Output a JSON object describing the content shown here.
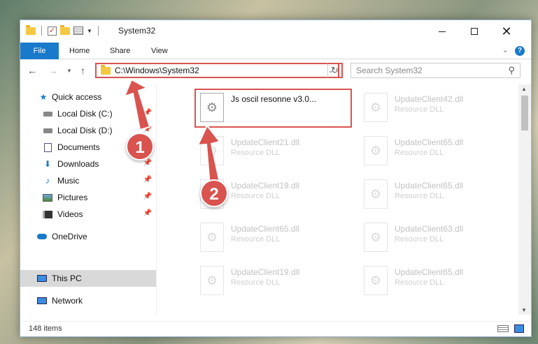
{
  "window": {
    "title": "System32",
    "minimize_icon": "minimize-icon",
    "maximize_icon": "maximize-icon",
    "close_glyph": "✕"
  },
  "ribbon": {
    "file_tab": "File",
    "tabs": [
      "Home",
      "Share",
      "View"
    ],
    "expand_glyph": "⌄",
    "help_glyph": "?"
  },
  "address": {
    "path": "C:\\Windows\\System32",
    "search_placeholder": "Search System32"
  },
  "sidebar": {
    "items": [
      {
        "label": "Quick access",
        "icon": "star-icon"
      },
      {
        "label": "Local Disk (C:)",
        "icon": "disk-icon",
        "pinned": true
      },
      {
        "label": "Local Disk (D:)",
        "icon": "disk-icon",
        "pinned": true
      },
      {
        "label": "Documents",
        "icon": "document-icon",
        "pinned": true
      },
      {
        "label": "Downloads",
        "icon": "download-icon",
        "pinned": true
      },
      {
        "label": "Music",
        "icon": "music-icon",
        "pinned": true
      },
      {
        "label": "Pictures",
        "icon": "picture-icon",
        "pinned": true
      },
      {
        "label": "Videos",
        "icon": "video-icon",
        "pinned": true
      },
      {
        "label": "OneDrive",
        "icon": "cloud-icon"
      },
      {
        "label": "This PC",
        "icon": "computer-icon",
        "selected": true
      },
      {
        "label": "Network",
        "icon": "network-icon"
      }
    ]
  },
  "files": [
    {
      "name": "Js oscil resonne v3.0...",
      "type": ""
    },
    {
      "name": "UpdateClient42.dll",
      "type": "Resource DLL"
    },
    {
      "name": "UpdateClient21.dll",
      "type": "Resource DLL"
    },
    {
      "name": "UpdateClient65.dll",
      "type": "Resource DLL"
    },
    {
      "name": "UpdateClient19.dll",
      "type": "Resource DLL"
    },
    {
      "name": "UpdateClient65.dll",
      "type": "Resource DLL"
    },
    {
      "name": "UpdateClient65.dll",
      "type": "Resource DLL"
    },
    {
      "name": "UpdateClient63.dll",
      "type": "Resource DLL"
    },
    {
      "name": "UpdateClient19.dll",
      "type": "Resource DLL"
    },
    {
      "name": "UpdateClient65.dll",
      "type": "Resource DLL"
    }
  ],
  "status": {
    "item_count": "148 items"
  },
  "annotations": {
    "step1": "1",
    "step2": "2",
    "color": "#d9534f"
  }
}
